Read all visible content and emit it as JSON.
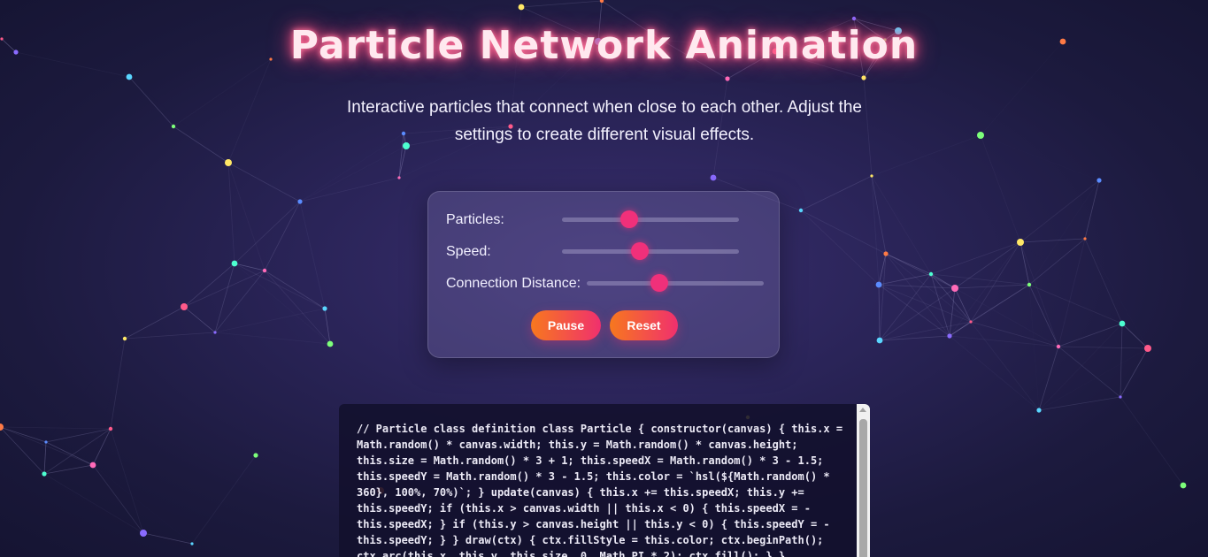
{
  "page": {
    "title": "Particle Network Animation",
    "subtitle": "Interactive particles that connect when close to each other. Adjust the settings to create different visual effects."
  },
  "controls": {
    "particles": {
      "label": "Particles:",
      "level": 0.38
    },
    "speed": {
      "label": "Speed:",
      "level": 0.44
    },
    "connection_distance": {
      "label": "Connection Distance:",
      "level": 0.41
    },
    "pause_label": "Pause",
    "reset_label": "Reset"
  },
  "code": {
    "text": "// Particle class definition class Particle { constructor(canvas) { this.x = Math.random() * canvas.width; this.y = Math.random() * canvas.height; this.size = Math.random() * 3 + 1; this.speedX = Math.random() * 3 - 1.5; this.speedY = Math.random() * 3 - 1.5; this.color = `hsl(${Math.random() * 360}, 100%, 70%)`; } update(canvas) { this.x += this.speedX; this.y += this.speedY; if (this.x > canvas.width || this.x < 0) { this.speedX = -this.speedX; } if (this.y > canvas.height || this.y < 0) { this.speedY = -this.speedY; } } draw(ctx) { ctx.fillStyle = this.color; ctx.beginPath(); ctx.arc(this.x, this.y, this.size, 0, Math.PI * 2); ctx.fill(); } }"
  },
  "colors": {
    "accent": "#f0307a",
    "button_gradient_start": "#f7781e",
    "button_gradient_end": "#f0306e",
    "title_glow": "#ff5a88",
    "particle_palette": [
      "#ff5a8a",
      "#8a6bff",
      "#5ad6ff",
      "#7dff7a",
      "#ffe866",
      "#ff7a45",
      "#5a8cff",
      "#4dffd1",
      "#ff6ab8"
    ]
  }
}
